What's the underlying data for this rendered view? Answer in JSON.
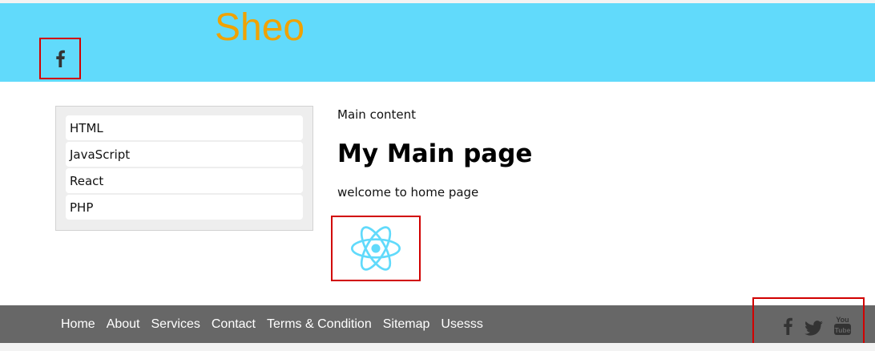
{
  "header": {
    "brand": "Sheo",
    "brand_color": "#f0a202",
    "background": "#61dafb",
    "social_icon": "facebook-icon"
  },
  "sidebar": {
    "items": [
      {
        "label": "HTML"
      },
      {
        "label": "JavaScript"
      },
      {
        "label": "React"
      },
      {
        "label": "PHP"
      }
    ]
  },
  "main": {
    "eyebrow": "Main content",
    "title": "My Main page",
    "welcome": "welcome to home page",
    "logo_icon": "react-logo-icon",
    "logo_color": "#61dafb"
  },
  "footer": {
    "background": "#676767",
    "links": [
      {
        "label": "Home"
      },
      {
        "label": "About"
      },
      {
        "label": "Services"
      },
      {
        "label": "Contact"
      },
      {
        "label": "Terms & Condition"
      },
      {
        "label": "Sitemap"
      },
      {
        "label": "Usesss"
      }
    ],
    "social_icons": [
      "facebook-icon",
      "twitter-icon",
      "youtube-icon"
    ]
  },
  "annotation_color": "#d10000"
}
